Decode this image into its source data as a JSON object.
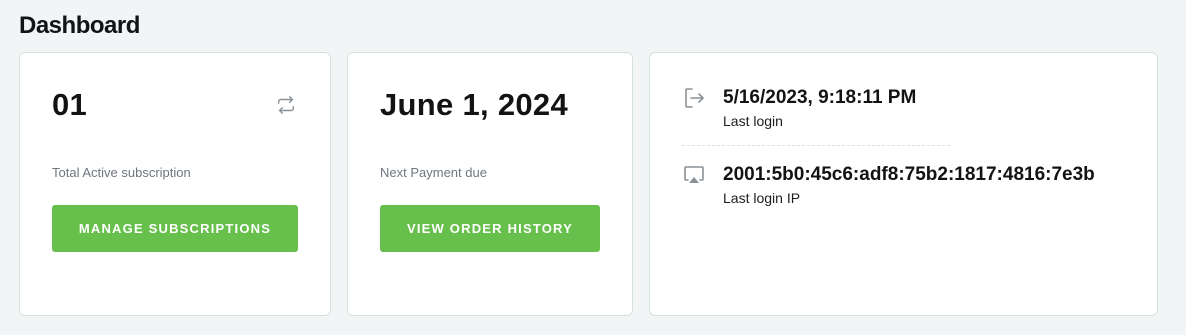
{
  "page": {
    "title": "Dashboard"
  },
  "cards": {
    "subscriptions": {
      "value": "01",
      "caption": "Total Active subscription",
      "button_label": "MANAGE SUBSCRIPTIONS",
      "icon": "refresh-icon"
    },
    "payment": {
      "value": "June 1, 2024",
      "caption": "Next Payment due",
      "button_label": "VIEW ORDER HISTORY"
    },
    "login": {
      "last_login_value": "5/16/2023, 9:18:11 PM",
      "last_login_label": "Last login",
      "last_login_icon": "sign-out-icon",
      "last_ip_value": "2001:5b0:45c6:adf8:75b2:1817:4816:7e3b",
      "last_ip_label": "Last login IP",
      "last_ip_icon": "screen-cast-icon"
    }
  },
  "colors": {
    "accent": "#68c04c",
    "card_border": "#d5e2dc",
    "background": "#f3f4f6",
    "muted_text": "#6f767e"
  }
}
